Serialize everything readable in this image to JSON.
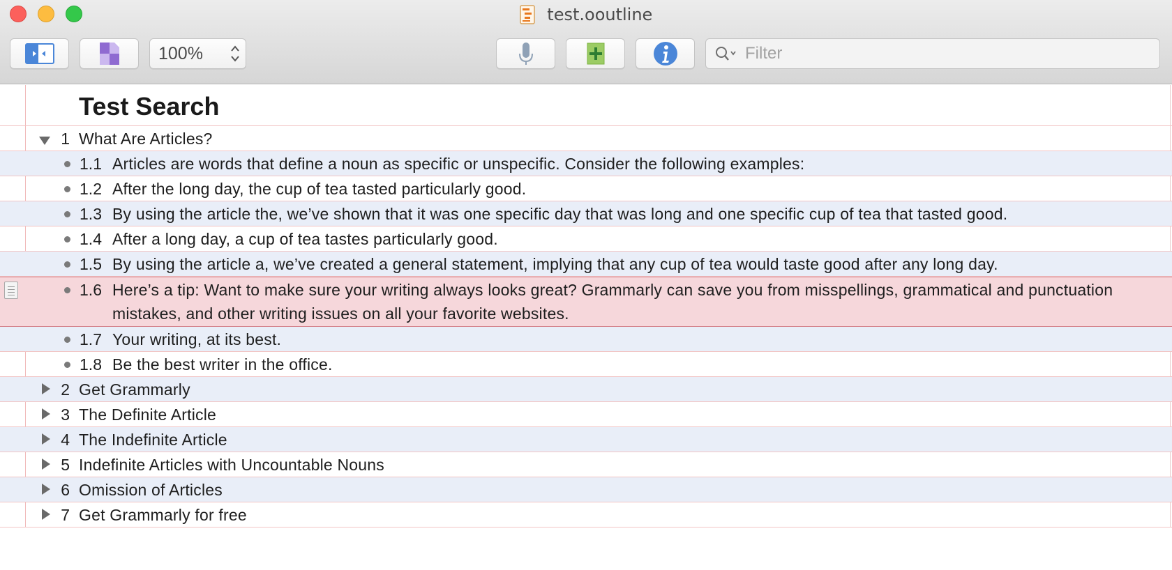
{
  "window": {
    "title": "test.ooutline"
  },
  "toolbar": {
    "zoom_value": "100%",
    "filter_placeholder": "Filter",
    "icons": {
      "sidebar": "sidebar-toggle-icon",
      "style": "style-panel-icon",
      "voice": "microphone-icon",
      "add": "add-row-icon",
      "info": "info-icon",
      "search": "search-icon"
    }
  },
  "outline": {
    "title": "Test Search",
    "rows": [
      {
        "level": 1,
        "num": "1",
        "text": "What Are Articles?",
        "toggle": "expanded"
      },
      {
        "level": 2,
        "num": "1.1",
        "text": "Articles are words that define a noun as specific or unspecific. Consider the following examples:"
      },
      {
        "level": 2,
        "num": "1.2",
        "text": "After the long day, the cup of tea tasted particularly good."
      },
      {
        "level": 2,
        "num": "1.3",
        "text": "By using the article the, we’ve shown that it was one specific day that was long and one specific cup of tea that tasted good."
      },
      {
        "level": 2,
        "num": "1.4",
        "text": "After a long day, a cup of tea tastes particularly good."
      },
      {
        "level": 2,
        "num": "1.5",
        "text": "By using the article a, we’ve created a general statement, implying that any cup of tea would taste good after any long day."
      },
      {
        "level": 2,
        "num": "1.6",
        "text": "Here’s a tip: Want to make sure your writing always looks great? Grammarly can save you from misspellings, grammatical and punctuation mistakes, and other writing issues on all your favorite websites.",
        "selected": true,
        "has_note": true
      },
      {
        "level": 2,
        "num": "1.7",
        "text": "Your writing, at its best."
      },
      {
        "level": 2,
        "num": "1.8",
        "text": "Be the best writer in the office."
      },
      {
        "level": 1,
        "num": "2",
        "text": "Get Grammarly",
        "toggle": "collapsed"
      },
      {
        "level": 1,
        "num": "3",
        "text": "The Definite Article",
        "toggle": "collapsed"
      },
      {
        "level": 1,
        "num": "4",
        "text": "The Indefinite Article",
        "toggle": "collapsed"
      },
      {
        "level": 1,
        "num": "5",
        "text": "Indefinite Articles with Uncountable Nouns",
        "toggle": "collapsed"
      },
      {
        "level": 1,
        "num": "6",
        "text": "Omission of Articles",
        "toggle": "collapsed"
      },
      {
        "level": 1,
        "num": "7",
        "text": "Get Grammarly for free",
        "toggle": "collapsed"
      }
    ]
  },
  "colors": {
    "row_alt": "#e9eef8",
    "row_selected": "#f6d7db",
    "margin_line": "#f0b8b8"
  }
}
